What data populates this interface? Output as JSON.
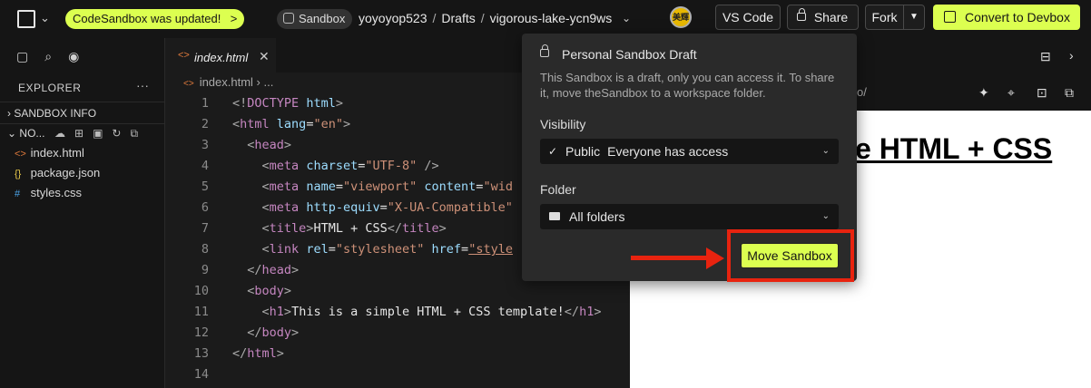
{
  "topbar": {
    "update_text": "CodeSandbox was updated!",
    "update_arrow": ">",
    "sandbox_label": "Sandbox",
    "user": "yoyoyop523",
    "drafts": "Drafts",
    "project": "vigorous-lake-ycn9ws",
    "avatar_text": "美輝",
    "vscode_label": "VS Code",
    "share_label": "Share",
    "fork_label": "Fork",
    "convert_label": "Convert to Devbox"
  },
  "sidebar": {
    "explorer_label": "EXPLORER",
    "sandbox_info": "SANDBOX INFO",
    "folder_label": "NO...",
    "files": [
      {
        "name": "index.html",
        "icon": "<>",
        "color": "#e07a3c"
      },
      {
        "name": "package.json",
        "icon": "{}",
        "color": "#e8c84a"
      },
      {
        "name": "styles.css",
        "icon": "#",
        "color": "#4aa3e8"
      }
    ]
  },
  "editor": {
    "tab_label": "index.html",
    "crumb_file": "index.html",
    "crumb_rest": "...",
    "line_numbers": [
      "1",
      "2",
      "3",
      "4",
      "5",
      "6",
      "7",
      "8",
      "9",
      "10",
      "11",
      "12",
      "13",
      "14"
    ]
  },
  "preview": {
    "url_fragment": "o/",
    "heading": "e HTML + CSS"
  },
  "popover": {
    "title": "Personal Sandbox Draft",
    "description": "This Sandbox is a draft, only you can access it. To share it, move theSandbox to a workspace folder.",
    "visibility_label": "Visibility",
    "visibility_value": "Public",
    "visibility_note": "Everyone has access",
    "folder_label": "Folder",
    "folder_value": "All folders",
    "move_button": "Move Sandbox"
  },
  "colors": {
    "accent": "#dcff50",
    "annotation": "#e8230f"
  }
}
